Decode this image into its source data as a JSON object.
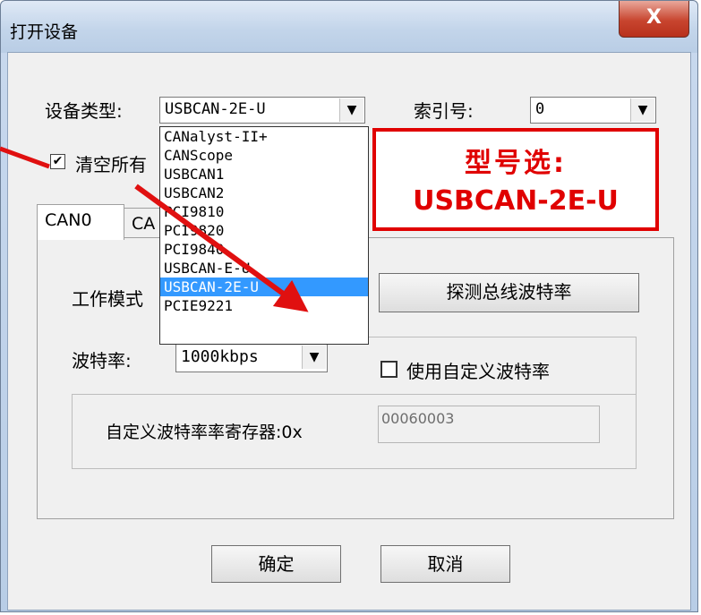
{
  "window": {
    "title": "打开设备",
    "close_glyph": "X"
  },
  "device_type": {
    "label": "设备类型:",
    "value": "USBCAN-2E-U"
  },
  "index": {
    "label": "索引号:",
    "value": "0"
  },
  "clear_all": {
    "label": "清空所有",
    "checked": true
  },
  "dropdown": {
    "options": [
      "CANalyst-II+",
      "CANScope",
      "USBCAN1",
      "USBCAN2",
      "PCI9810",
      "PCI9820",
      "PCI9840",
      "USBCAN-E-U",
      "USBCAN-2E-U",
      "PCIE9221"
    ],
    "selected_index": 8
  },
  "callout": {
    "line1": "型号选:",
    "line2": "USBCAN-2E-U",
    "color": "#e00000"
  },
  "tabs": [
    {
      "label": "CAN0"
    },
    {
      "label": "CA"
    }
  ],
  "work_mode": {
    "label": "工作模式"
  },
  "detect_button": {
    "label": "探测总线波特率"
  },
  "baud": {
    "label": "波特率:",
    "value": "1000kbps"
  },
  "custom_baud": {
    "label": "使用自定义波特率",
    "checked": false
  },
  "custom_register": {
    "label": "自定义波特率率寄存器:0x",
    "value": "00060003"
  },
  "buttons": {
    "ok": "确定",
    "cancel": "取消"
  },
  "colors": {
    "selection": "#3399ff",
    "arrow": "#e01010"
  }
}
